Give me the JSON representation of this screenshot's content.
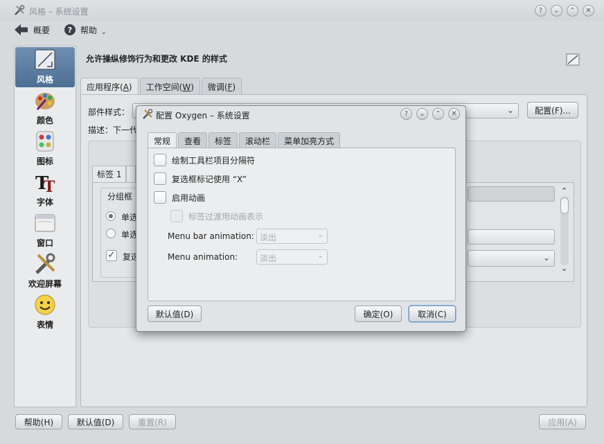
{
  "window": {
    "title": "风格 – 系统设置",
    "toolbar": {
      "overview_label": "概要",
      "help_label": "帮助"
    },
    "title_buttons": {
      "help": "?",
      "minimize": "⌄",
      "maximize": "⌃",
      "close": "✕"
    }
  },
  "sidebar": {
    "items": [
      {
        "label": "风格",
        "icon": "style-icon",
        "active": true
      },
      {
        "label": "颜色",
        "icon": "color-palette-icon"
      },
      {
        "label": "图标",
        "icon": "icons-icon"
      },
      {
        "label": "字体",
        "icon": "font-icon"
      },
      {
        "label": "窗口",
        "icon": "window-icon"
      },
      {
        "label": "欢迎屏幕",
        "icon": "tools-icon"
      },
      {
        "label": "表情",
        "icon": "smiley-icon"
      }
    ]
  },
  "main": {
    "heading": "允许操纵修饰行为和更改 KDE 的样式",
    "tabs": [
      {
        "label": "应用程序",
        "accel": "A",
        "active": true
      },
      {
        "label": "工作空间",
        "accel": "W"
      },
      {
        "label": "微调",
        "accel": "F"
      }
    ],
    "widget_style_label": "部件样式：",
    "configure_button": "配置(F)...",
    "description_label": "描述：下一代",
    "preview": {
      "tab_label": "标签 1",
      "group_label": "分组框",
      "radio1": "单选",
      "radio2": "单选",
      "checkbox": "复选"
    }
  },
  "footer": {
    "help_button": "帮助(H)",
    "defaults_button": "默认值(D)",
    "reset_button": "重置(R)",
    "apply_button": "应用(A)"
  },
  "dialog": {
    "title": "配置 Oxygen – 系统设置",
    "tabs": [
      "常规",
      "查看",
      "标签",
      "滚动栏",
      "菜单加亮方式"
    ],
    "options": {
      "toolbar_separator": "绘制工具栏项目分隔符",
      "checkbox_x": "复选框标记使用 “X”",
      "animations": "启用动画",
      "tab_transitions": "标签过渡用动画表示"
    },
    "menu_bar_animation": {
      "label": "Menu bar animation:",
      "value": "淡出"
    },
    "menu_animation": {
      "label": "Menu animation:",
      "value": "淡出"
    },
    "buttons": {
      "defaults": "默认值(D)",
      "ok": "确定(O)",
      "cancel": "取消(C)"
    }
  }
}
